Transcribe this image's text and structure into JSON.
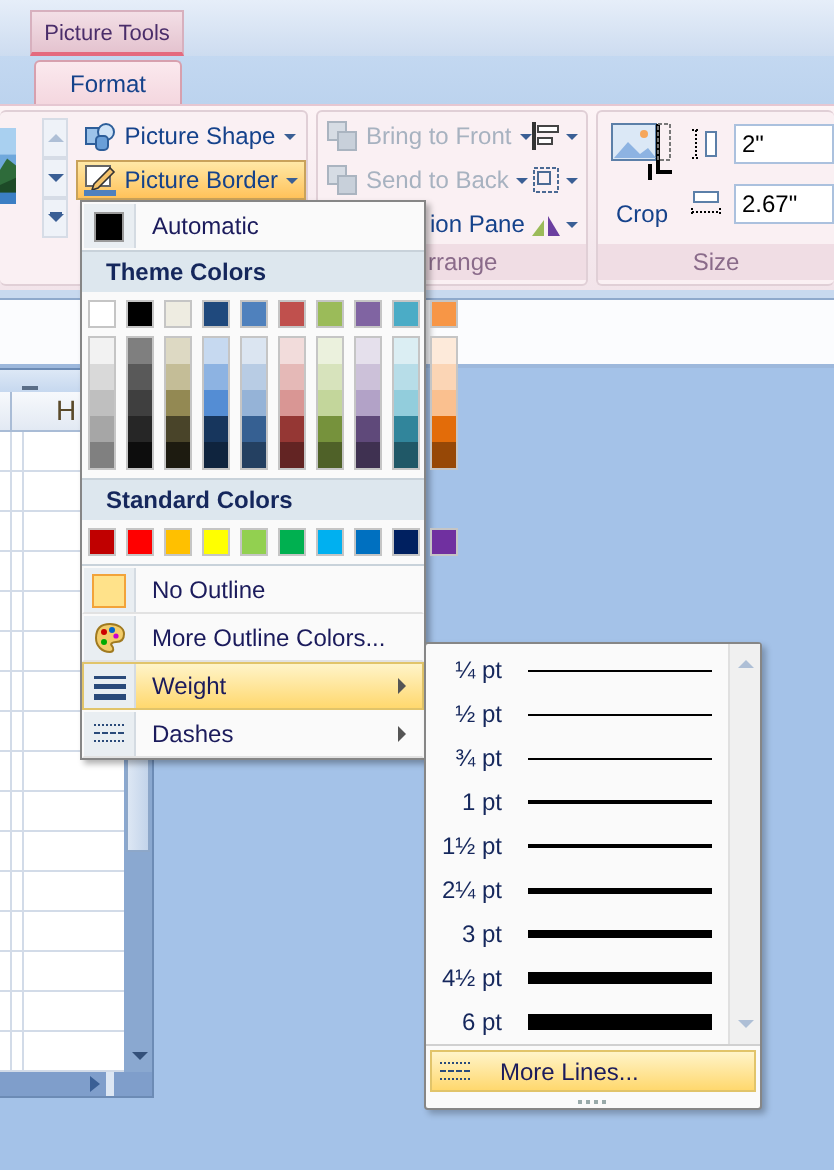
{
  "contextual_tab": {
    "label": "Picture Tools"
  },
  "tabs": [
    {
      "label": "Format",
      "selected": true
    }
  ],
  "ribbon": {
    "picture_buttons": [
      {
        "label": "Picture Shape",
        "kind": "shape",
        "selected": false
      },
      {
        "label": "Picture Border",
        "kind": "border",
        "selected": true
      }
    ],
    "arrange_buttons": [
      {
        "label": "Bring to Front",
        "kind": "front",
        "disabled": true
      },
      {
        "label": "Send to Back",
        "kind": "back",
        "disabled": true
      },
      {
        "label": "ion Pane",
        "kind": "pane",
        "disabled": false
      }
    ],
    "arrange_label": "rrange",
    "crop": {
      "label": "Crop"
    },
    "height_field": {
      "value": "2\""
    },
    "width_field": {
      "value": "2.67\""
    },
    "size_label": "Size"
  },
  "sheet": {
    "column_header": "H"
  },
  "border_menu": {
    "automatic": {
      "label": "Automatic",
      "color": "#000000"
    },
    "theme_heading": "Theme Colors",
    "theme_colors": [
      {
        "color": "#ffffff",
        "shades": [
          {
            "color": "#f2f2f2"
          },
          {
            "color": "#d9d9d9"
          },
          {
            "color": "#bfbfbf"
          },
          {
            "color": "#a6a6a6"
          },
          {
            "color": "#808080"
          }
        ]
      },
      {
        "color": "#000000",
        "shades": [
          {
            "color": "#7f7f7f"
          },
          {
            "color": "#595959"
          },
          {
            "color": "#3f3f3f"
          },
          {
            "color": "#262626"
          },
          {
            "color": "#0d0d0d"
          }
        ]
      },
      {
        "color": "#eeece1",
        "shades": [
          {
            "color": "#ddd9c3"
          },
          {
            "color": "#c4bd97"
          },
          {
            "color": "#938953"
          },
          {
            "color": "#494429"
          },
          {
            "color": "#1d1b10"
          }
        ]
      },
      {
        "color": "#1f497d",
        "shades": [
          {
            "color": "#c6d9f0"
          },
          {
            "color": "#8db3e2"
          },
          {
            "color": "#548dd4"
          },
          {
            "color": "#17365d"
          },
          {
            "color": "#0f243e"
          }
        ]
      },
      {
        "color": "#4f81bd",
        "shades": [
          {
            "color": "#dbe5f1"
          },
          {
            "color": "#b8cce4"
          },
          {
            "color": "#95b3d7"
          },
          {
            "color": "#366092"
          },
          {
            "color": "#244061"
          }
        ]
      },
      {
        "color": "#c0504d",
        "shades": [
          {
            "color": "#f2dcdb"
          },
          {
            "color": "#e5b9b7"
          },
          {
            "color": "#d99694"
          },
          {
            "color": "#953734"
          },
          {
            "color": "#632423"
          }
        ]
      },
      {
        "color": "#9bbb59",
        "shades": [
          {
            "color": "#ebf1dd"
          },
          {
            "color": "#d7e3bc"
          },
          {
            "color": "#c3d69b"
          },
          {
            "color": "#76923c"
          },
          {
            "color": "#4f6128"
          }
        ]
      },
      {
        "color": "#8064a2",
        "shades": [
          {
            "color": "#e5e0ec"
          },
          {
            "color": "#ccc1d9"
          },
          {
            "color": "#b2a2c7"
          },
          {
            "color": "#5f497a"
          },
          {
            "color": "#3f3151"
          }
        ]
      },
      {
        "color": "#4bacc6",
        "shades": [
          {
            "color": "#dbeef3"
          },
          {
            "color": "#b7dde8"
          },
          {
            "color": "#92cddc"
          },
          {
            "color": "#31859b"
          },
          {
            "color": "#205867"
          }
        ]
      },
      {
        "color": "#f79646",
        "shades": [
          {
            "color": "#fdeada"
          },
          {
            "color": "#fbd5b5"
          },
          {
            "color": "#fac08f"
          },
          {
            "color": "#e36c09"
          },
          {
            "color": "#974806"
          }
        ]
      }
    ],
    "standard_heading": "Standard Colors",
    "standard_colors": [
      {
        "color": "#c00000"
      },
      {
        "color": "#ff0000"
      },
      {
        "color": "#ffc000"
      },
      {
        "color": "#ffff00"
      },
      {
        "color": "#92d050"
      },
      {
        "color": "#00b050"
      },
      {
        "color": "#00b0f0"
      },
      {
        "color": "#0070c0"
      },
      {
        "color": "#002060"
      },
      {
        "color": "#7030a0"
      }
    ],
    "items": [
      {
        "kind": "no-outline",
        "label": "No Outline",
        "selected": false
      },
      {
        "kind": "more-colors",
        "label": "More Outline Colors...",
        "selected": false
      },
      {
        "kind": "weight",
        "label": "Weight",
        "selected": true
      },
      {
        "kind": "dashes",
        "label": "Dashes",
        "selected": false
      }
    ]
  },
  "weight_menu": {
    "weights": [
      {
        "label": "¼ pt"
      },
      {
        "label": "½ pt"
      },
      {
        "label": "¾ pt"
      },
      {
        "label": "1 pt"
      },
      {
        "label": "1½ pt"
      },
      {
        "label": "2¼ pt"
      },
      {
        "label": "3 pt"
      },
      {
        "label": "4½ pt"
      },
      {
        "label": "6 pt"
      }
    ],
    "more": {
      "label": "More Lines...",
      "selected": true
    }
  }
}
